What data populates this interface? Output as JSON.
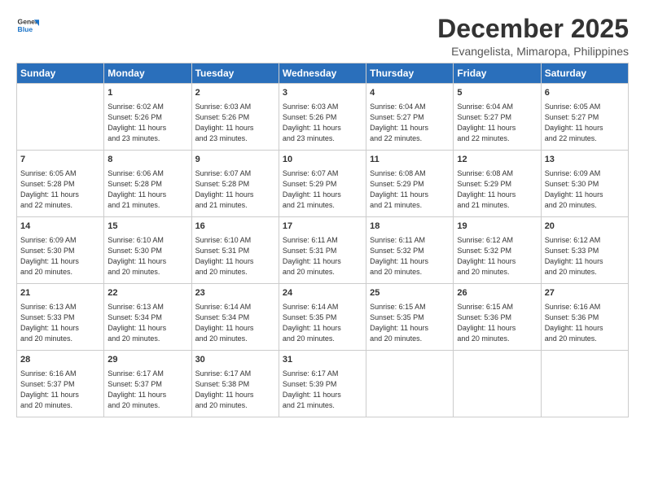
{
  "logo": {
    "line1": "General",
    "line2": "Blue"
  },
  "title": "December 2025",
  "subtitle": "Evangelista, Mimaropa, Philippines",
  "days_of_week": [
    "Sunday",
    "Monday",
    "Tuesday",
    "Wednesday",
    "Thursday",
    "Friday",
    "Saturday"
  ],
  "weeks": [
    [
      {
        "day": "",
        "info": ""
      },
      {
        "day": "1",
        "info": "Sunrise: 6:02 AM\nSunset: 5:26 PM\nDaylight: 11 hours\nand 23 minutes."
      },
      {
        "day": "2",
        "info": "Sunrise: 6:03 AM\nSunset: 5:26 PM\nDaylight: 11 hours\nand 23 minutes."
      },
      {
        "day": "3",
        "info": "Sunrise: 6:03 AM\nSunset: 5:26 PM\nDaylight: 11 hours\nand 23 minutes."
      },
      {
        "day": "4",
        "info": "Sunrise: 6:04 AM\nSunset: 5:27 PM\nDaylight: 11 hours\nand 22 minutes."
      },
      {
        "day": "5",
        "info": "Sunrise: 6:04 AM\nSunset: 5:27 PM\nDaylight: 11 hours\nand 22 minutes."
      },
      {
        "day": "6",
        "info": "Sunrise: 6:05 AM\nSunset: 5:27 PM\nDaylight: 11 hours\nand 22 minutes."
      }
    ],
    [
      {
        "day": "7",
        "info": "Sunrise: 6:05 AM\nSunset: 5:28 PM\nDaylight: 11 hours\nand 22 minutes."
      },
      {
        "day": "8",
        "info": "Sunrise: 6:06 AM\nSunset: 5:28 PM\nDaylight: 11 hours\nand 21 minutes."
      },
      {
        "day": "9",
        "info": "Sunrise: 6:07 AM\nSunset: 5:28 PM\nDaylight: 11 hours\nand 21 minutes."
      },
      {
        "day": "10",
        "info": "Sunrise: 6:07 AM\nSunset: 5:29 PM\nDaylight: 11 hours\nand 21 minutes."
      },
      {
        "day": "11",
        "info": "Sunrise: 6:08 AM\nSunset: 5:29 PM\nDaylight: 11 hours\nand 21 minutes."
      },
      {
        "day": "12",
        "info": "Sunrise: 6:08 AM\nSunset: 5:29 PM\nDaylight: 11 hours\nand 21 minutes."
      },
      {
        "day": "13",
        "info": "Sunrise: 6:09 AM\nSunset: 5:30 PM\nDaylight: 11 hours\nand 20 minutes."
      }
    ],
    [
      {
        "day": "14",
        "info": "Sunrise: 6:09 AM\nSunset: 5:30 PM\nDaylight: 11 hours\nand 20 minutes."
      },
      {
        "day": "15",
        "info": "Sunrise: 6:10 AM\nSunset: 5:30 PM\nDaylight: 11 hours\nand 20 minutes."
      },
      {
        "day": "16",
        "info": "Sunrise: 6:10 AM\nSunset: 5:31 PM\nDaylight: 11 hours\nand 20 minutes."
      },
      {
        "day": "17",
        "info": "Sunrise: 6:11 AM\nSunset: 5:31 PM\nDaylight: 11 hours\nand 20 minutes."
      },
      {
        "day": "18",
        "info": "Sunrise: 6:11 AM\nSunset: 5:32 PM\nDaylight: 11 hours\nand 20 minutes."
      },
      {
        "day": "19",
        "info": "Sunrise: 6:12 AM\nSunset: 5:32 PM\nDaylight: 11 hours\nand 20 minutes."
      },
      {
        "day": "20",
        "info": "Sunrise: 6:12 AM\nSunset: 5:33 PM\nDaylight: 11 hours\nand 20 minutes."
      }
    ],
    [
      {
        "day": "21",
        "info": "Sunrise: 6:13 AM\nSunset: 5:33 PM\nDaylight: 11 hours\nand 20 minutes."
      },
      {
        "day": "22",
        "info": "Sunrise: 6:13 AM\nSunset: 5:34 PM\nDaylight: 11 hours\nand 20 minutes."
      },
      {
        "day": "23",
        "info": "Sunrise: 6:14 AM\nSunset: 5:34 PM\nDaylight: 11 hours\nand 20 minutes."
      },
      {
        "day": "24",
        "info": "Sunrise: 6:14 AM\nSunset: 5:35 PM\nDaylight: 11 hours\nand 20 minutes."
      },
      {
        "day": "25",
        "info": "Sunrise: 6:15 AM\nSunset: 5:35 PM\nDaylight: 11 hours\nand 20 minutes."
      },
      {
        "day": "26",
        "info": "Sunrise: 6:15 AM\nSunset: 5:36 PM\nDaylight: 11 hours\nand 20 minutes."
      },
      {
        "day": "27",
        "info": "Sunrise: 6:16 AM\nSunset: 5:36 PM\nDaylight: 11 hours\nand 20 minutes."
      }
    ],
    [
      {
        "day": "28",
        "info": "Sunrise: 6:16 AM\nSunset: 5:37 PM\nDaylight: 11 hours\nand 20 minutes."
      },
      {
        "day": "29",
        "info": "Sunrise: 6:17 AM\nSunset: 5:37 PM\nDaylight: 11 hours\nand 20 minutes."
      },
      {
        "day": "30",
        "info": "Sunrise: 6:17 AM\nSunset: 5:38 PM\nDaylight: 11 hours\nand 20 minutes."
      },
      {
        "day": "31",
        "info": "Sunrise: 6:17 AM\nSunset: 5:39 PM\nDaylight: 11 hours\nand 21 minutes."
      },
      {
        "day": "",
        "info": ""
      },
      {
        "day": "",
        "info": ""
      },
      {
        "day": "",
        "info": ""
      }
    ]
  ]
}
